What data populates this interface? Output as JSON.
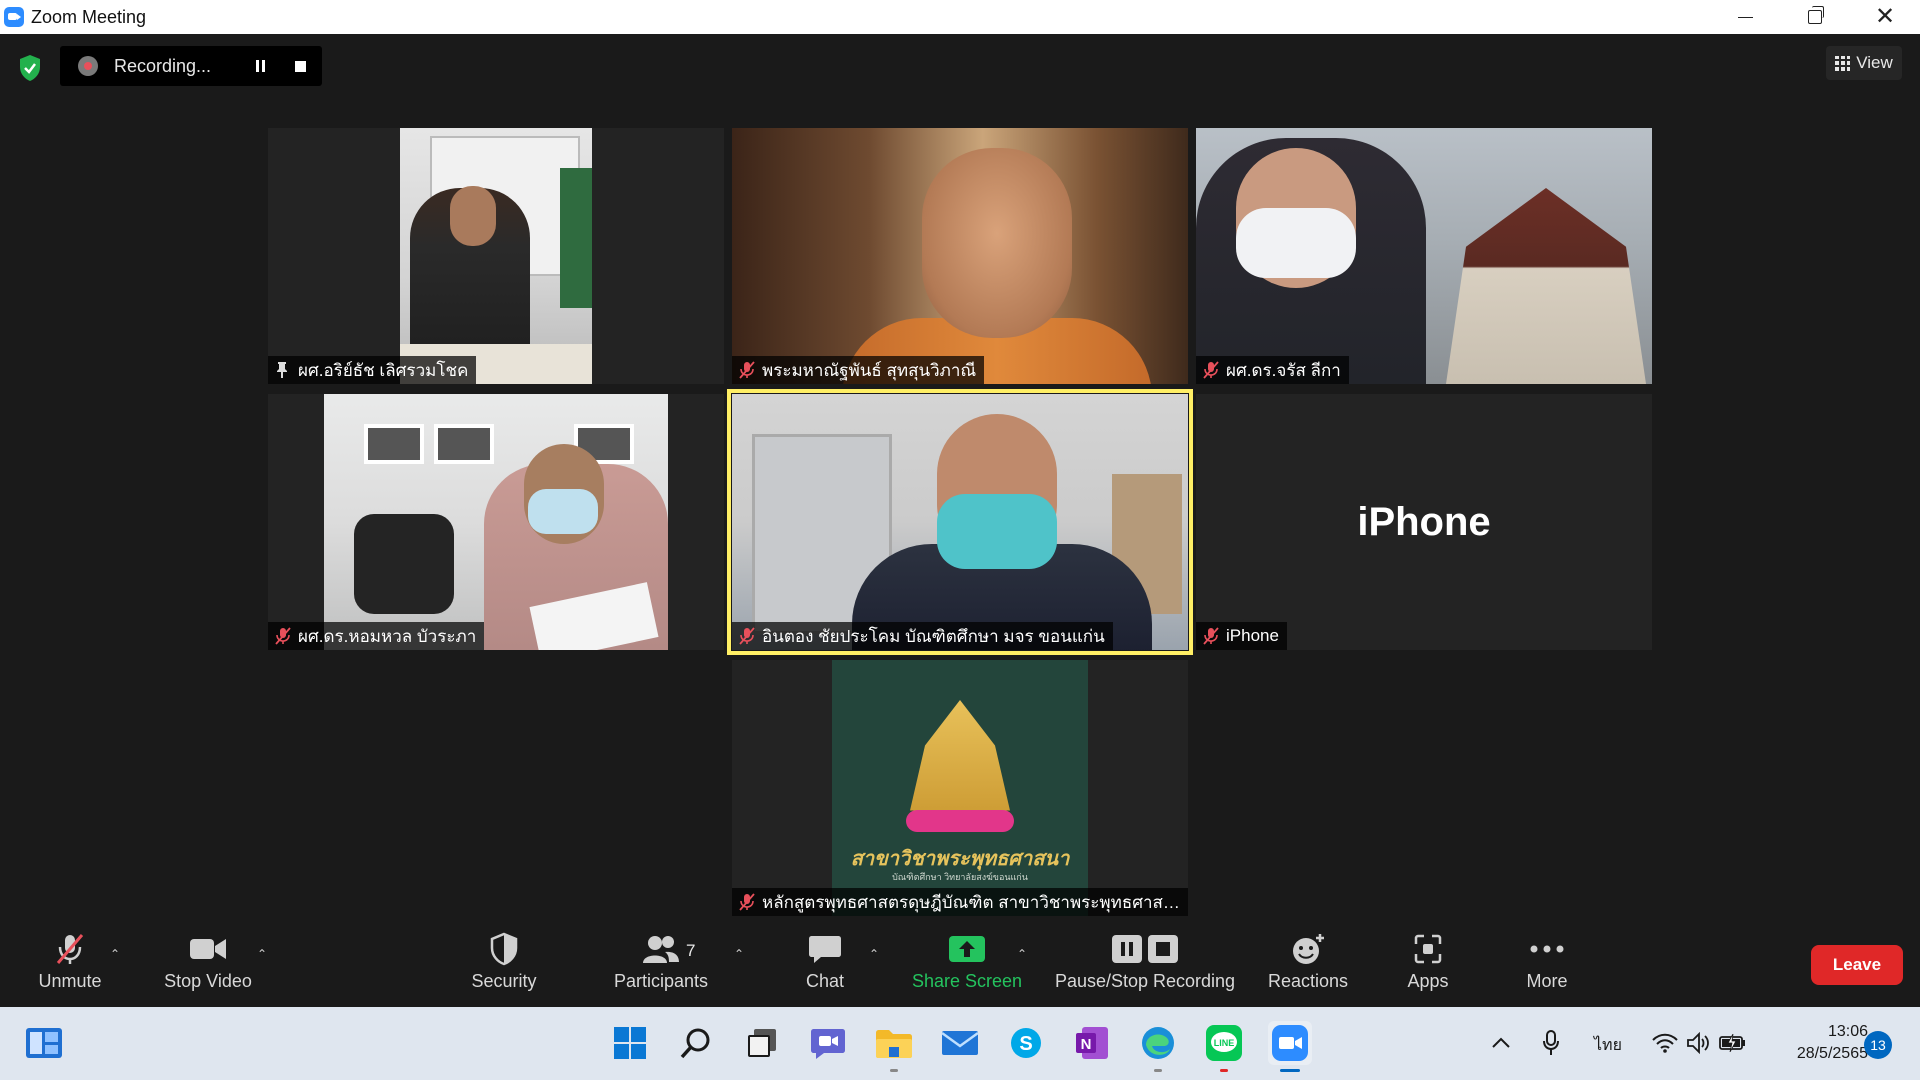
{
  "window": {
    "title": "Zoom Meeting"
  },
  "recording": {
    "status": "Recording..."
  },
  "view": {
    "label": "View"
  },
  "tiles": [
    {
      "name": "ผศ.อริย์ธัช เลิศรวมโชค",
      "muted": false,
      "pinned": true
    },
    {
      "name": "พระมหาณัฐพันธ์ สุทสุนวิภาณี",
      "muted": true
    },
    {
      "name": "ผศ.ดร.จรัส ลีกา",
      "muted": true
    },
    {
      "name": "ผศ.ดร.หอมหวล บัวระภา",
      "muted": true
    },
    {
      "name": "อินตอง ชัยประโคม บัณฑิตศึกษา มจร ขอนแก่น",
      "muted": true,
      "active": true
    },
    {
      "name": "iPhone",
      "muted": true,
      "display_label": "iPhone"
    },
    {
      "name": "หลักสูตรพุทธศาสตรดุษฎีบัณฑิต สาขาวิชาพระพุทธศาสน...",
      "muted": true
    }
  ],
  "tile7_logo": {
    "caption": "สาขาวิชาพระพุทธศาสนา",
    "subcaption": "บัณฑิตศึกษา วิทยาลัยสงฆ์ขอนแก่น"
  },
  "toolbar": {
    "unmute": "Unmute",
    "stop_video": "Stop Video",
    "security": "Security",
    "participants": "Participants",
    "participants_count": "7",
    "chat": "Chat",
    "share_screen": "Share Screen",
    "pause_stop_recording": "Pause/Stop Recording",
    "reactions": "Reactions",
    "apps": "Apps",
    "more": "More",
    "leave": "Leave"
  },
  "taskbar": {
    "language": "ไทย",
    "time": "13:06",
    "date": "28/5/2565",
    "notifications": "13"
  },
  "colors": {
    "accent": "#2d8cff",
    "active_speaker": "#ffef65",
    "share_green": "#24c35e",
    "leave_red": "#e02828",
    "muted_red": "#e8505b"
  }
}
